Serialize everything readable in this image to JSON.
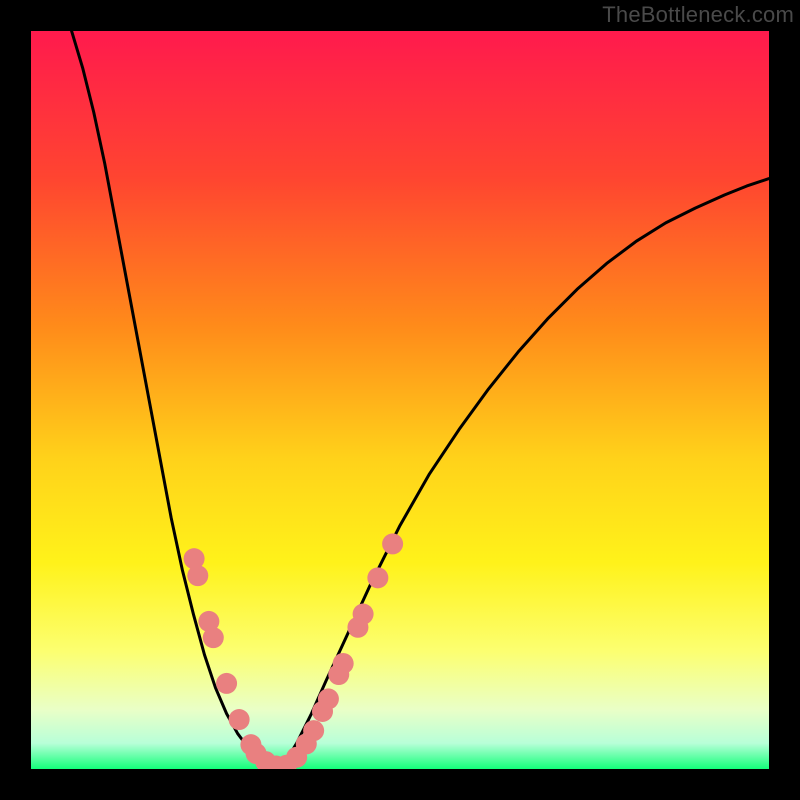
{
  "attribution": "TheBottleneck.com",
  "chart_data": {
    "type": "line",
    "title": "",
    "xlabel": "",
    "ylabel": "",
    "xlim": [
      0,
      1
    ],
    "ylim": [
      0,
      1
    ],
    "gradient_stops": [
      {
        "offset": 0.0,
        "color": "#ff1a4d"
      },
      {
        "offset": 0.2,
        "color": "#ff4530"
      },
      {
        "offset": 0.4,
        "color": "#ff8b1a"
      },
      {
        "offset": 0.58,
        "color": "#ffd21a"
      },
      {
        "offset": 0.72,
        "color": "#fff21a"
      },
      {
        "offset": 0.84,
        "color": "#fcff70"
      },
      {
        "offset": 0.92,
        "color": "#e9ffc7"
      },
      {
        "offset": 0.965,
        "color": "#b8ffd8"
      },
      {
        "offset": 1.0,
        "color": "#13ff7a"
      }
    ],
    "series": [
      {
        "name": "left-curve",
        "stroke": "#000000",
        "points": [
          {
            "x": 0.055,
            "y": 1.0
          },
          {
            "x": 0.07,
            "y": 0.95
          },
          {
            "x": 0.085,
            "y": 0.89
          },
          {
            "x": 0.1,
            "y": 0.82
          },
          {
            "x": 0.115,
            "y": 0.74
          },
          {
            "x": 0.13,
            "y": 0.66
          },
          {
            "x": 0.145,
            "y": 0.58
          },
          {
            "x": 0.16,
            "y": 0.5
          },
          {
            "x": 0.175,
            "y": 0.42
          },
          {
            "x": 0.19,
            "y": 0.34
          },
          {
            "x": 0.205,
            "y": 0.27
          },
          {
            "x": 0.22,
            "y": 0.21
          },
          {
            "x": 0.235,
            "y": 0.155
          },
          {
            "x": 0.25,
            "y": 0.11
          },
          {
            "x": 0.265,
            "y": 0.075
          },
          {
            "x": 0.28,
            "y": 0.048
          },
          {
            "x": 0.295,
            "y": 0.028
          },
          {
            "x": 0.31,
            "y": 0.014
          },
          {
            "x": 0.325,
            "y": 0.006
          },
          {
            "x": 0.34,
            "y": 0.002
          }
        ]
      },
      {
        "name": "right-curve",
        "stroke": "#000000",
        "points": [
          {
            "x": 0.34,
            "y": 0.002
          },
          {
            "x": 0.36,
            "y": 0.035
          },
          {
            "x": 0.38,
            "y": 0.075
          },
          {
            "x": 0.4,
            "y": 0.12
          },
          {
            "x": 0.43,
            "y": 0.185
          },
          {
            "x": 0.46,
            "y": 0.25
          },
          {
            "x": 0.5,
            "y": 0.33
          },
          {
            "x": 0.54,
            "y": 0.4
          },
          {
            "x": 0.58,
            "y": 0.46
          },
          {
            "x": 0.62,
            "y": 0.515
          },
          {
            "x": 0.66,
            "y": 0.565
          },
          {
            "x": 0.7,
            "y": 0.61
          },
          {
            "x": 0.74,
            "y": 0.65
          },
          {
            "x": 0.78,
            "y": 0.685
          },
          {
            "x": 0.82,
            "y": 0.715
          },
          {
            "x": 0.86,
            "y": 0.74
          },
          {
            "x": 0.9,
            "y": 0.76
          },
          {
            "x": 0.94,
            "y": 0.778
          },
          {
            "x": 0.97,
            "y": 0.79
          },
          {
            "x": 1.0,
            "y": 0.8
          }
        ]
      }
    ],
    "marker_clusters": [
      {
        "name": "left-branch-markers",
        "color": "#e98080",
        "points": [
          {
            "x": 0.221,
            "y": 0.285
          },
          {
            "x": 0.226,
            "y": 0.262
          },
          {
            "x": 0.241,
            "y": 0.2
          },
          {
            "x": 0.247,
            "y": 0.178
          },
          {
            "x": 0.265,
            "y": 0.116
          },
          {
            "x": 0.282,
            "y": 0.067
          },
          {
            "x": 0.298,
            "y": 0.033
          }
        ]
      },
      {
        "name": "bottom-markers",
        "color": "#e98080",
        "points": [
          {
            "x": 0.305,
            "y": 0.021
          },
          {
            "x": 0.318,
            "y": 0.01
          },
          {
            "x": 0.332,
            "y": 0.004
          },
          {
            "x": 0.346,
            "y": 0.005
          },
          {
            "x": 0.36,
            "y": 0.016
          },
          {
            "x": 0.373,
            "y": 0.034
          }
        ]
      },
      {
        "name": "right-branch-markers",
        "color": "#e98080",
        "points": [
          {
            "x": 0.383,
            "y": 0.052
          },
          {
            "x": 0.395,
            "y": 0.078
          },
          {
            "x": 0.403,
            "y": 0.095
          },
          {
            "x": 0.417,
            "y": 0.128
          },
          {
            "x": 0.423,
            "y": 0.143
          },
          {
            "x": 0.443,
            "y": 0.192
          },
          {
            "x": 0.45,
            "y": 0.21
          },
          {
            "x": 0.47,
            "y": 0.259
          },
          {
            "x": 0.49,
            "y": 0.305
          }
        ]
      }
    ]
  }
}
